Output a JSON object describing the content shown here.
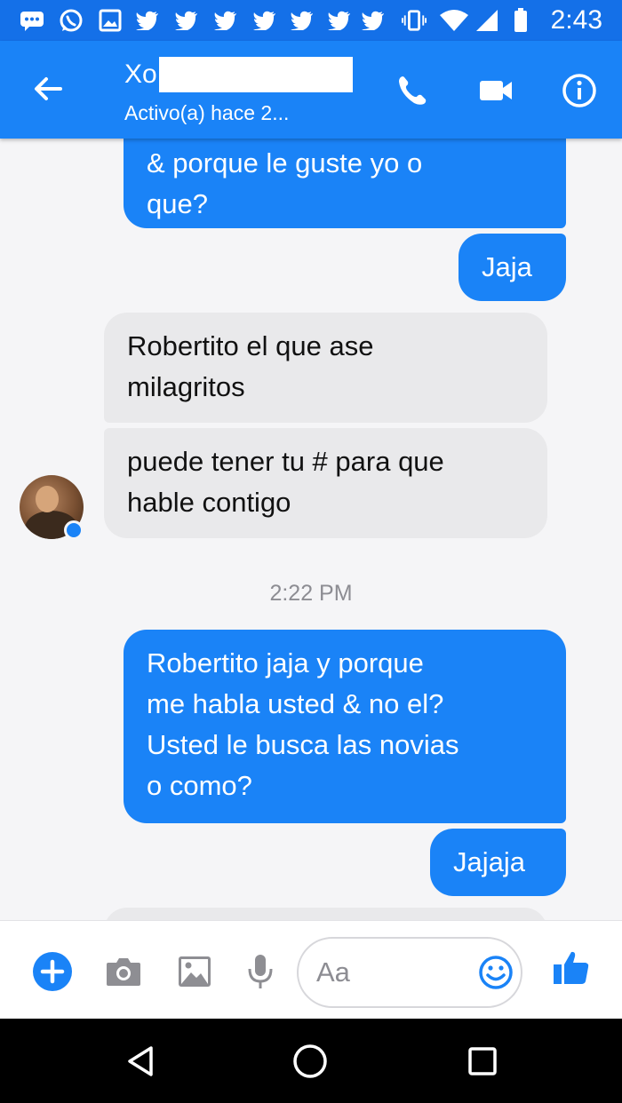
{
  "status_bar": {
    "time": "2:43",
    "icons": [
      "message-icon",
      "whatsapp-icon",
      "image-icon",
      "twitter-icon",
      "twitter-icon",
      "twitter-icon",
      "twitter-icon",
      "twitter-icon",
      "twitter-icon",
      "twitter-icon",
      "vibrate-icon",
      "wifi-icon",
      "signal-icon",
      "battery-icon"
    ]
  },
  "header": {
    "contact_name": "Xo",
    "status": "Activo(a) hace 2..."
  },
  "messages": [
    {
      "direction": "outgoing",
      "text": "& porque le guste yo o\nque?"
    },
    {
      "direction": "outgoing",
      "text": "Jaja"
    },
    {
      "direction": "incoming",
      "text": "Robertito el que ase\nmilagritos"
    },
    {
      "direction": "incoming",
      "text": "puede tener tu # para que\nhable contigo"
    },
    {
      "direction": "timestamp",
      "text": "2:22 PM"
    },
    {
      "direction": "outgoing",
      "text": "Robertito jaja y porque\nme habla usted & no el?\nUsted le busca las novias\no como?"
    },
    {
      "direction": "outgoing",
      "text": "Jajaja"
    },
    {
      "direction": "incoming",
      "text": ""
    }
  ],
  "composer": {
    "placeholder": "Aa",
    "value": ""
  },
  "colors": {
    "messenger_blue": "#1a83f7",
    "status_bar_blue": "#1470e8",
    "incoming_bubble": "#e9e9eb",
    "chat_background": "#f5f5f7"
  }
}
